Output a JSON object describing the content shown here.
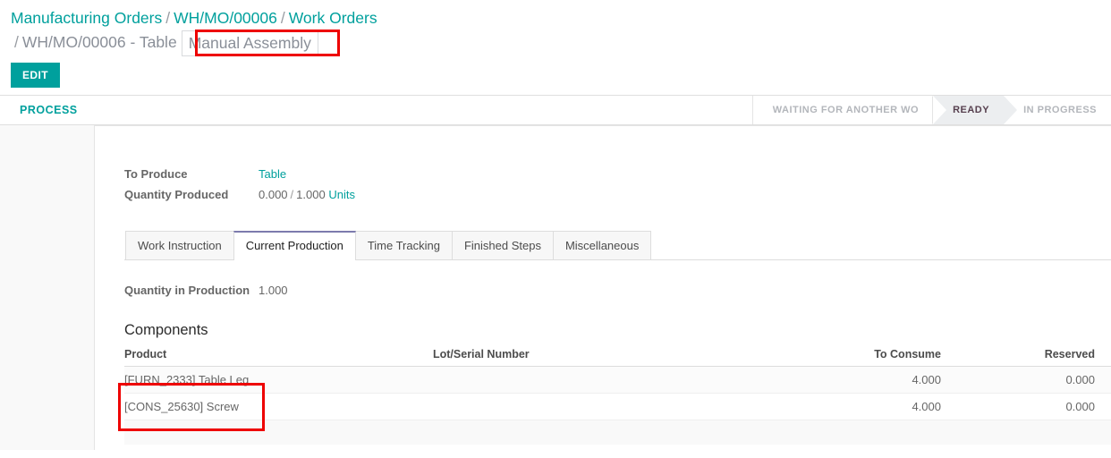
{
  "breadcrumb": {
    "items": [
      {
        "label": "Manufacturing Orders",
        "type": "link"
      },
      {
        "label": "WH/MO/00006",
        "type": "link"
      },
      {
        "label": "Work Orders",
        "type": "link"
      },
      {
        "label": "WH/MO/00006 - Table",
        "type": "current"
      }
    ],
    "separator": "/",
    "active_record": "Manual Assembly"
  },
  "toolbar": {
    "edit_label": "EDIT"
  },
  "statusbar": {
    "process_button": "PROCESS",
    "states": [
      {
        "label": "WAITING FOR ANOTHER WO",
        "active": false
      },
      {
        "label": "READY",
        "active": true
      },
      {
        "label": "IN PROGRESS",
        "active": false
      }
    ]
  },
  "form": {
    "to_produce_label": "To Produce",
    "to_produce_value": "Table",
    "quantity_produced_label": "Quantity Produced",
    "quantity_done": "0.000",
    "quantity_separator": "/",
    "quantity_target": "1.000",
    "quantity_uom": "Units"
  },
  "notebook": {
    "tabs": [
      {
        "label": "Work Instruction",
        "active": false
      },
      {
        "label": "Current Production",
        "active": true
      },
      {
        "label": "Time Tracking",
        "active": false
      },
      {
        "label": "Finished Steps",
        "active": false
      },
      {
        "label": "Miscellaneous",
        "active": false
      }
    ]
  },
  "current_production": {
    "quantity_in_production_label": "Quantity in Production",
    "quantity_in_production_value": "1.000",
    "components_title": "Components",
    "columns": [
      "Product",
      "Lot/Serial Number",
      "To Consume",
      "Reserved"
    ],
    "rows": [
      {
        "product": "[FURN_2333] Table Leg",
        "lot_serial": "",
        "to_consume": "4.000",
        "reserved": "0.000"
      },
      {
        "product": "[CONS_25630] Screw",
        "lot_serial": "",
        "to_consume": "4.000",
        "reserved": "0.000"
      }
    ]
  },
  "colors": {
    "accent": "#00A09D",
    "annotation": "#ee0000",
    "tab_active_border": "#7c7bad",
    "state_active_bg": "#eceef0"
  }
}
